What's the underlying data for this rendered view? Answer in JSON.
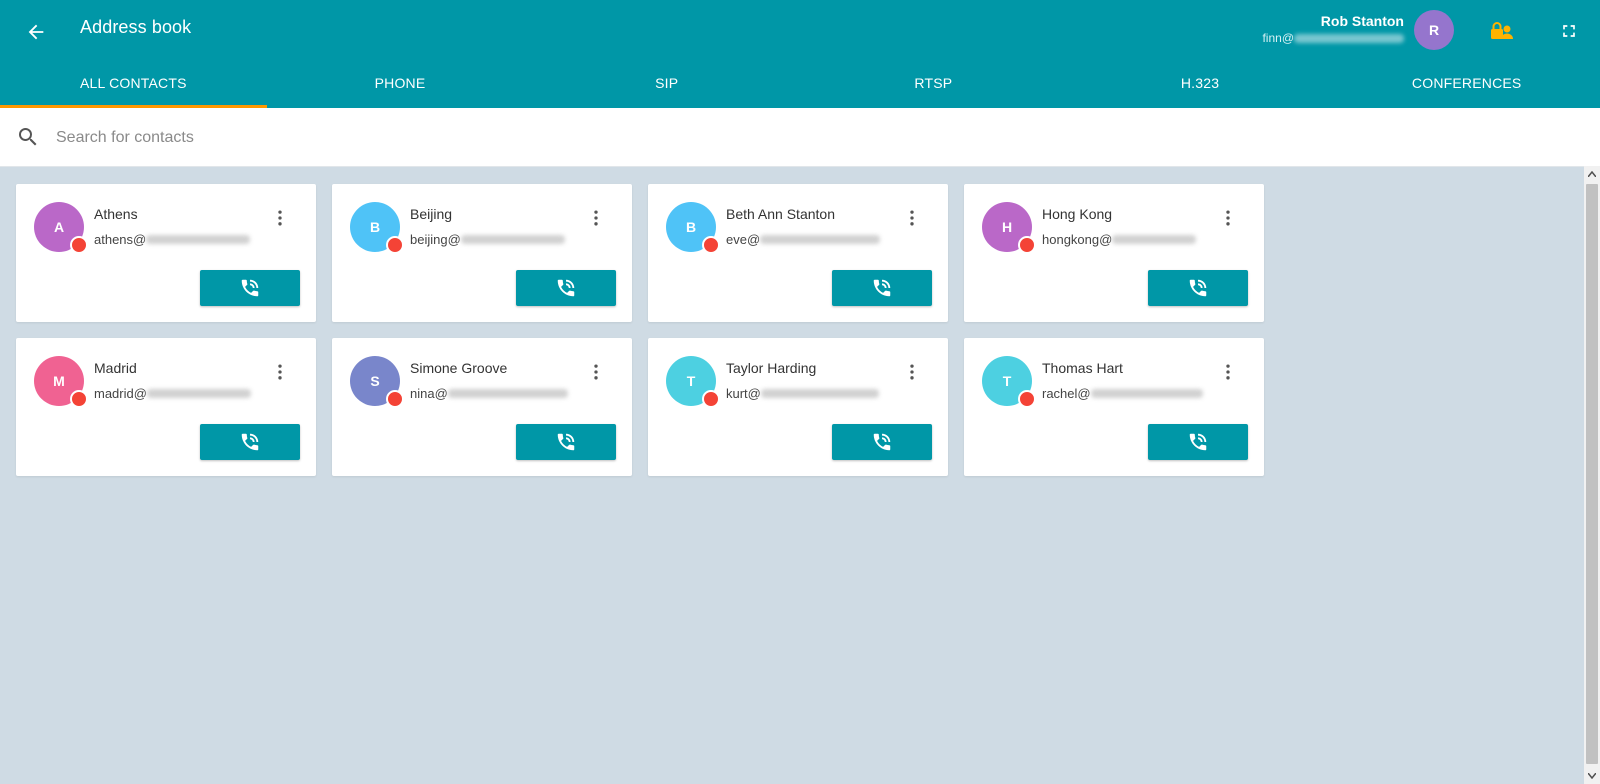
{
  "header": {
    "title": "Address book",
    "user_name": "Rob Stanton",
    "user_email_prefix": "finn@",
    "user_initial": "R"
  },
  "icons": {
    "back": "arrow-left-icon",
    "lock": "lock-user-icon",
    "fullscreen": "fullscreen-icon",
    "search": "search-icon",
    "more": "more-vert-icon",
    "call": "phone-call-icon"
  },
  "colors": {
    "primary": "#0097a7",
    "tab_indicator": "#ff9800",
    "status_offline": "#f44336",
    "background": "#cfdbe4",
    "lock_icon": "#ffb300"
  },
  "tabs": [
    {
      "label": "ALL CONTACTS",
      "active": true
    },
    {
      "label": "PHONE",
      "active": false
    },
    {
      "label": "SIP",
      "active": false
    },
    {
      "label": "RTSP",
      "active": false
    },
    {
      "label": "H.323",
      "active": false
    },
    {
      "label": "CONFERENCES",
      "active": false
    }
  ],
  "search": {
    "placeholder": "Search for contacts",
    "value": ""
  },
  "contacts": [
    {
      "name": "Athens",
      "email_prefix": "athens@",
      "initial": "A",
      "avatar_color": "#ba68c8"
    },
    {
      "name": "Beijing",
      "email_prefix": "beijing@",
      "initial": "B",
      "avatar_color": "#4fc3f7"
    },
    {
      "name": "Beth Ann Stanton",
      "email_prefix": "eve@",
      "initial": "B",
      "avatar_color": "#4fc3f7"
    },
    {
      "name": "Hong Kong",
      "email_prefix": "hongkong@",
      "initial": "H",
      "avatar_color": "#ba68c8"
    },
    {
      "name": "Madrid",
      "email_prefix": "madrid@",
      "initial": "M",
      "avatar_color": "#f06292"
    },
    {
      "name": "Simone Groove",
      "email_prefix": "nina@",
      "initial": "S",
      "avatar_color": "#7986cb"
    },
    {
      "name": "Taylor Harding",
      "email_prefix": "kurt@",
      "initial": "T",
      "avatar_color": "#4dd0e1"
    },
    {
      "name": "Thomas Hart",
      "email_prefix": "rachel@",
      "initial": "T",
      "avatar_color": "#4dd0e1"
    }
  ]
}
